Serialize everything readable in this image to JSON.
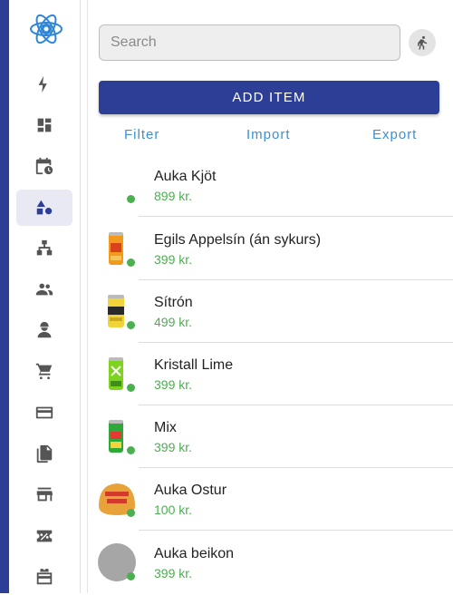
{
  "app": {
    "accent_color": "#2d3e96",
    "status_color": "#4caf50",
    "link_color": "#3d8fd0"
  },
  "sidebar": {
    "logo": "atom-gear-logo",
    "items": [
      {
        "icon": "bolt-icon",
        "active": false
      },
      {
        "icon": "dashboard-icon",
        "active": false
      },
      {
        "icon": "calendar-clock-icon",
        "active": false
      },
      {
        "icon": "shapes-icon",
        "active": true
      },
      {
        "icon": "org-chart-icon",
        "active": false
      },
      {
        "icon": "people-icon",
        "active": false
      },
      {
        "icon": "worker-icon",
        "active": false
      },
      {
        "icon": "cart-icon",
        "active": false
      },
      {
        "icon": "credit-card-icon",
        "active": false
      },
      {
        "icon": "documents-icon",
        "active": false
      },
      {
        "icon": "store-icon",
        "active": false
      },
      {
        "icon": "discount-icon",
        "active": false
      },
      {
        "icon": "gift-card-icon",
        "active": false
      }
    ]
  },
  "search": {
    "placeholder": "Search",
    "value": ""
  },
  "toolbar": {
    "runner_icon": "running-person-icon",
    "add_label": "ADD ITEM"
  },
  "actions": {
    "filter": "Filter",
    "import": "Import",
    "export": "Export"
  },
  "items": [
    {
      "name": "Auka Kjöt",
      "price": "899 kr.",
      "image": "none"
    },
    {
      "name": "Egils Appelsín (án sykurs)",
      "price": "399 kr.",
      "image": "orange-can"
    },
    {
      "name": "Sítrón",
      "price": "499 kr.",
      "image": "yellow-can"
    },
    {
      "name": "Kristall Lime",
      "price": "399 kr.",
      "image": "green-can"
    },
    {
      "name": "Mix",
      "price": "399 kr.",
      "image": "green-red-can"
    },
    {
      "name": "Auka Ostur",
      "price": "100 kr.",
      "image": "cheese-badge"
    },
    {
      "name": "Auka beikon",
      "price": "399 kr.",
      "image": "grey-circle"
    }
  ]
}
